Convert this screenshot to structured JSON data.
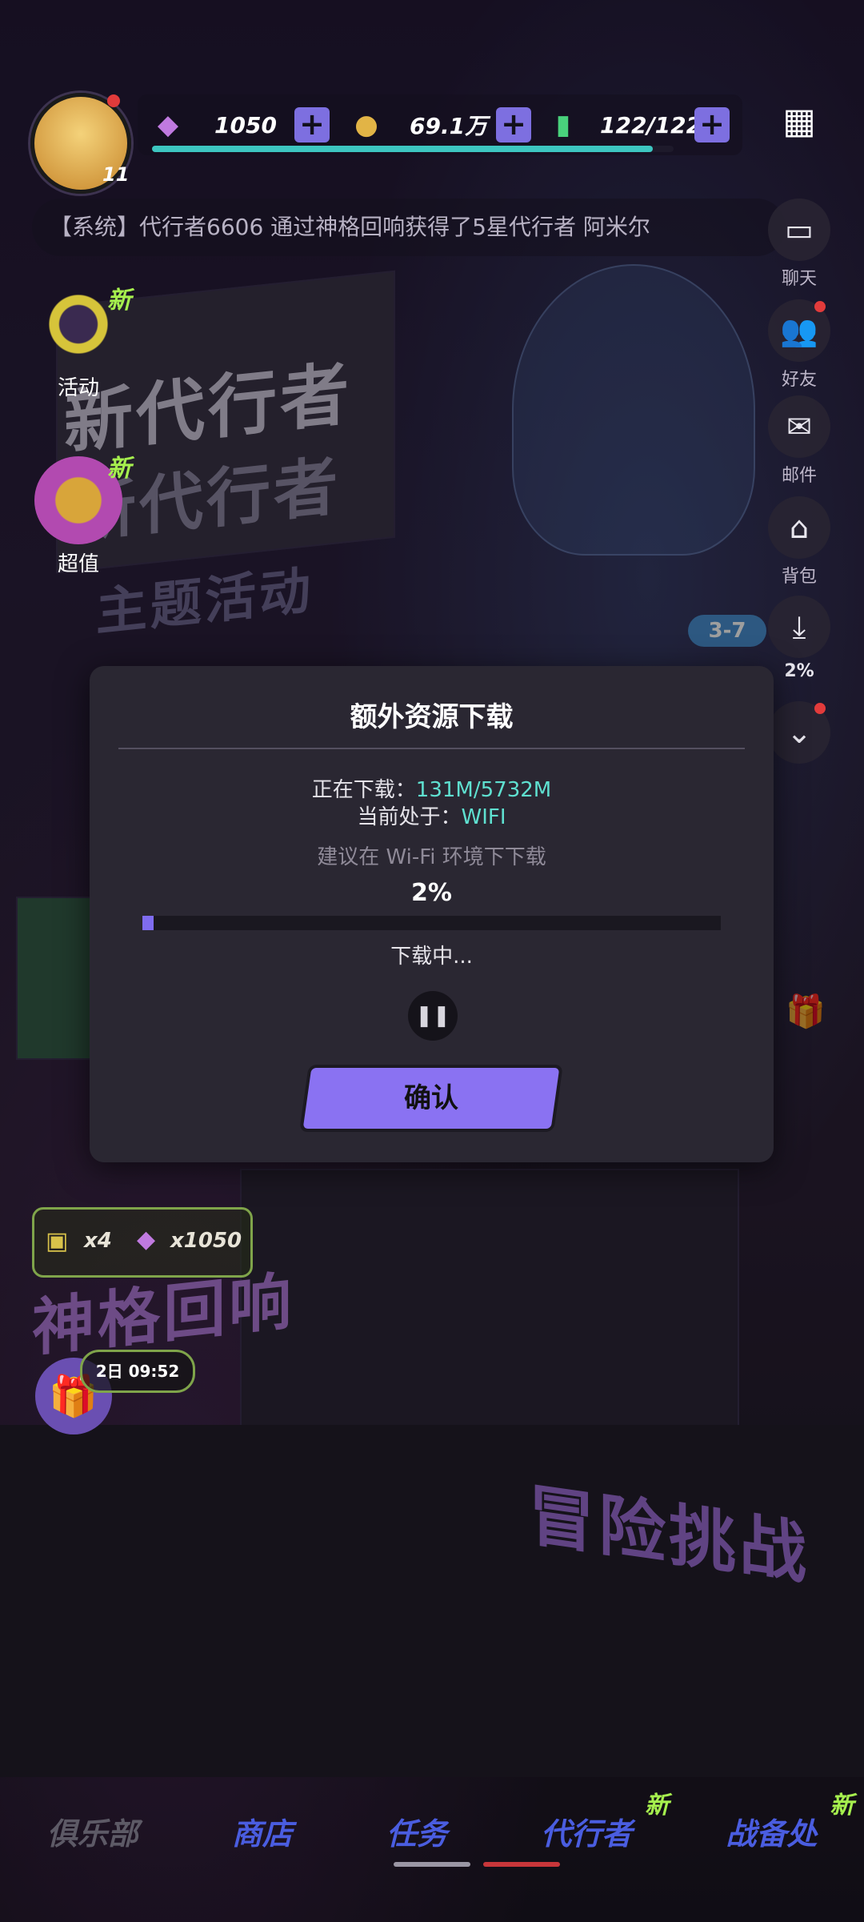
{
  "hud": {
    "level": "11",
    "gems": "1050",
    "coins": "69.1万",
    "energy": "122/122"
  },
  "ticker": {
    "text": "【系统】代行者6606 通过神格回响获得了5星代行者 阿米尔"
  },
  "left_icons": [
    {
      "label": "活动",
      "new": "新"
    },
    {
      "label": "超值",
      "new": "新"
    }
  ],
  "right_icons": [
    {
      "label": "聊天",
      "icon": "chat-icon"
    },
    {
      "label": "好友",
      "icon": "friends-icon"
    },
    {
      "label": "邮件",
      "icon": "mail-icon"
    },
    {
      "label": "背包",
      "icon": "bag-icon"
    },
    {
      "label": "2%",
      "icon": "download-icon"
    }
  ],
  "stage_tag": "3-7",
  "modal": {
    "title": "额外资源下载",
    "downloading_label": "正在下载：",
    "downloading_value": "131M/5732M",
    "network_label": "当前处于：",
    "network_value": "WIFI",
    "hint": "建议在 Wi-Fi 环境下下载",
    "percent": "2%",
    "progress": 0.02,
    "status": "下载中...",
    "confirm": "确认"
  },
  "events": {
    "chip_ticket_count": "x4",
    "chip_gem_count": "x1050",
    "banner_left": "神格回响",
    "timer": "2日 09:52",
    "banner_right": "冒险挑战",
    "billboard_top": "新代行者",
    "billboard_main": "新代行者",
    "billboard_sub": "主题活动"
  },
  "bottom_nav": [
    {
      "label": "俱乐部",
      "new": ""
    },
    {
      "label": "商店",
      "new": ""
    },
    {
      "label": "任务",
      "new": ""
    },
    {
      "label": "代行者",
      "new": "新"
    },
    {
      "label": "战备处",
      "new": "新"
    }
  ],
  "colors": {
    "accent": "#8a72f2",
    "teal": "#5fe0d0",
    "new_green": "#a6f04e"
  }
}
